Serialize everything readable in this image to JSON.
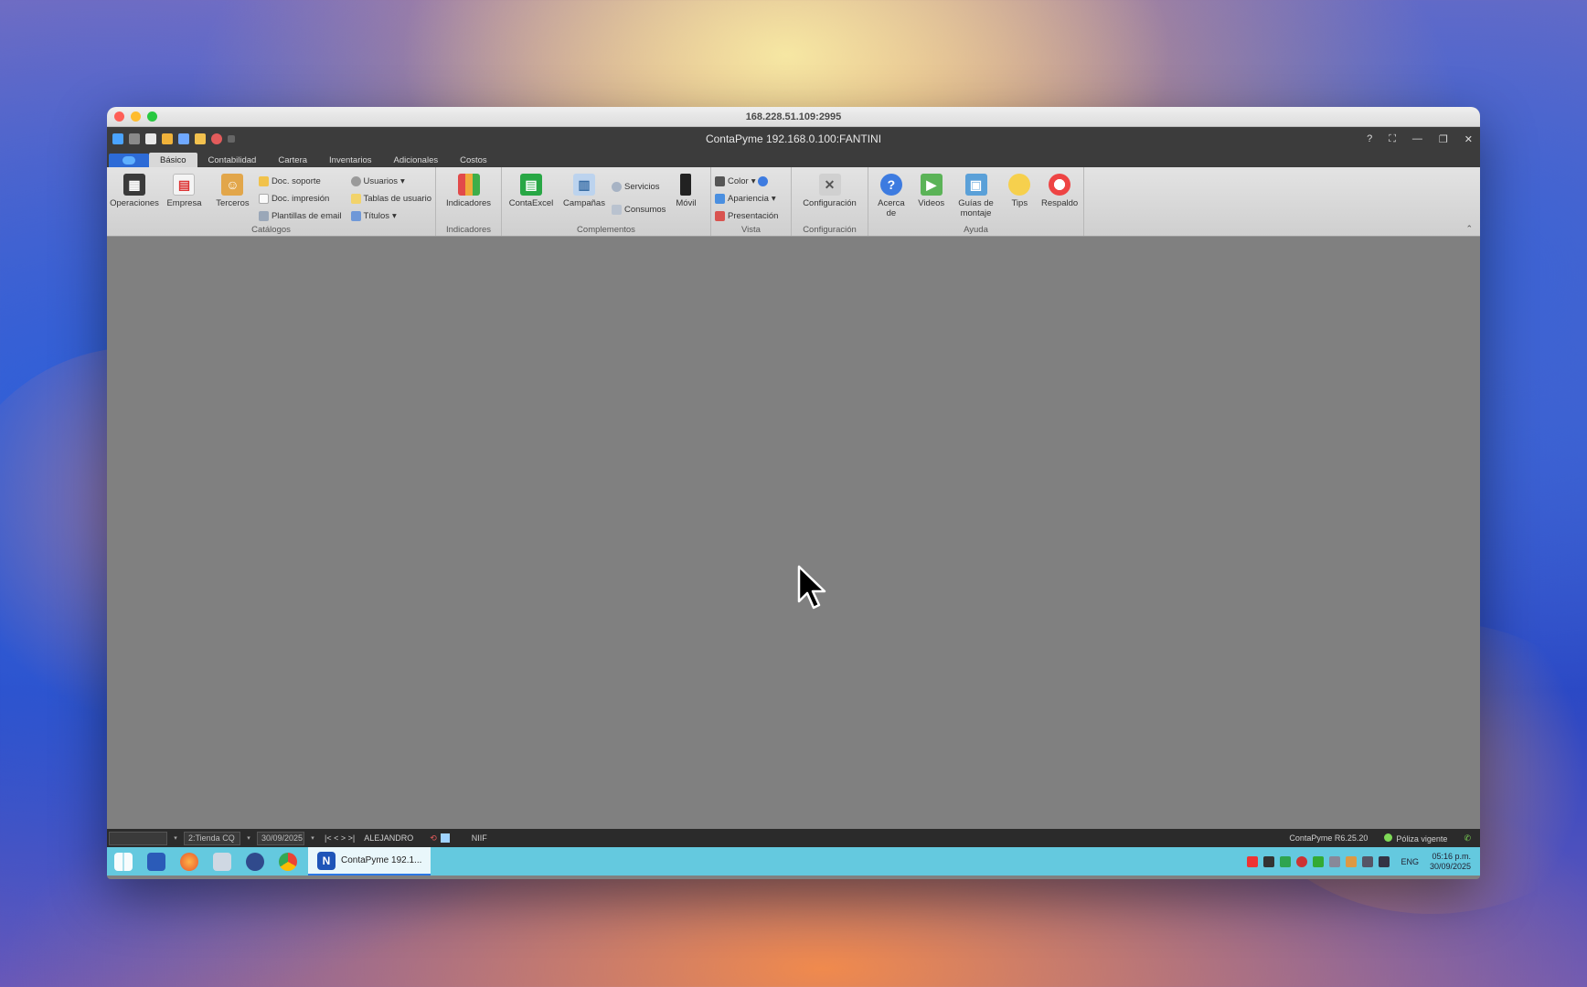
{
  "mac_window": {
    "title": "168.228.51.109:2995"
  },
  "app": {
    "title": "ContaPyme 192.168.0.100:FANTINI",
    "window_controls": [
      "?",
      "⛶",
      "—",
      "❐",
      "✕"
    ]
  },
  "tabs": [
    "Básico",
    "Contabilidad",
    "Cartera",
    "Inventarios",
    "Adicionales",
    "Costos"
  ],
  "ribbon": {
    "catalogos": {
      "label": "Catálogos",
      "big": [
        "Operaciones",
        "Empresa",
        "Terceros"
      ],
      "small_col1": [
        "Doc. soporte",
        "Doc. impresión",
        "Plantillas de email"
      ],
      "small_col2": [
        "Usuarios",
        "Tablas de usuario",
        "Títulos"
      ]
    },
    "indicadores": {
      "label": "Indicadores",
      "big": [
        "Indicadores"
      ]
    },
    "complementos": {
      "label": "Complementos",
      "big": [
        "ContaExcel",
        "Campañas"
      ],
      "small": [
        "Servicios",
        "Consumos"
      ],
      "big2": [
        "Móvil"
      ]
    },
    "vista": {
      "label": "Vista",
      "small": [
        "Color",
        "Apariencia",
        "Presentación"
      ]
    },
    "configuracion": {
      "label": "Configuración",
      "big": [
        "Configuración"
      ]
    },
    "ayuda": {
      "label": "Ayuda",
      "big": [
        "Acerca de",
        "Videos",
        "Guías de montaje",
        "Tips",
        "Respaldo"
      ]
    }
  },
  "statusbar": {
    "field1": "",
    "field2": "2:Tienda CQ",
    "field3": "30/09/2025",
    "nav": "|< < > >|",
    "user": "ALEJANDRO",
    "mode": "NIIF",
    "version": "ContaPyme R6.25.20",
    "policy": "Póliza vigente"
  },
  "taskbar": {
    "active_app": "ContaPyme 192.1...",
    "lang": "ENG",
    "time": "05:16 p.m.",
    "date": "30/09/2025"
  },
  "colors": {
    "app_chrome": "#3c3c3c",
    "ribbon": "#d8d8d8",
    "workspace": "#808080",
    "taskbar": "#64c9df"
  }
}
